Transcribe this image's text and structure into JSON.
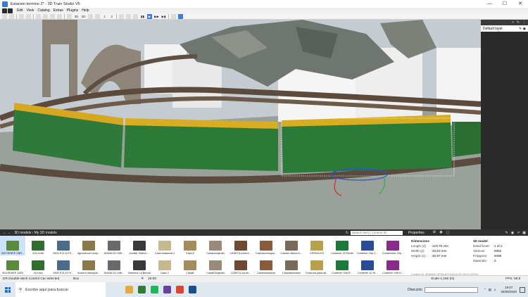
{
  "window": {
    "title": "Estacion termino 2* - 3D Train Studio V5",
    "controls": [
      "—",
      "☐",
      "✕"
    ]
  },
  "menu": [
    "Edit",
    "View",
    "Catalog",
    "Extras",
    "Plugins",
    "Help"
  ],
  "toolbar": {
    "view_3d": "3D",
    "view_2d": "2D",
    "num_1": "1",
    "num_3": "3",
    "play": "▶",
    "pause": "▮▮",
    "ffwd": "▶▶",
    "end": "▶▮"
  },
  "layers": {
    "layer_name": "Default layer"
  },
  "library": {
    "breadcrumb": "3D models › My 3D models",
    "search_placeholder": "Search item | Content ID",
    "row1": [
      "269 RENFE VBR...",
      "319 renfe",
      "5000 R.E.N.F.E...",
      "Agricultural comp...",
      "ANUNCIO LIMI...",
      "Auxiliar Station ...",
      "Casa andaluza 1",
      "Casa E",
      "Casacorujardin",
      "CASETA control ...",
      "Casetaconsigna...",
      "Caseta oficios m...",
      "CEREALES",
      "Contener 20 Renfe",
      "Contener 20p C...",
      "Contenedor 20p..."
    ],
    "row2": [
      "303 RENFE 1953",
      "319 tosi",
      "5000 R.E.N.F.E...",
      "Ancient trainstyle...",
      "ANUNCIO LIMI...",
      "Bahnhof La Brinda",
      "Casa C",
      "CasaB",
      "CasaE2tejardin",
      "CASETA via eb...",
      "Casetadedotras",
      "Casetasemales",
      "Columna yasa ati...",
      "Contener 20ft R...",
      "Contener 40 Hi...",
      "Contener 40ft H..."
    ]
  },
  "properties": {
    "title": "Properties",
    "dimensions_heading": "Dimensions",
    "length_label": "Length (x):",
    "length_value": "123,75 mm",
    "width_label": "Width (y):",
    "width_value": "20,53 mm",
    "height_label": "Height (z):",
    "height_value": "30,67 mm",
    "models_heading": "3D model",
    "detail_label": "Detail level:",
    "detail_value": "1 of 2",
    "vertices_label": "Vertices:",
    "vertices_value": "9352",
    "polygons_label": "Polygons:",
    "polygons_value": "8498",
    "materials_label": "Materials:",
    "materials_value": "3",
    "content_id": "Content ID: 8E6934E-9F56-4EF4-8218-2FC3D47CDF00",
    "fps": "FPS: 59,9"
  },
  "status": {
    "selection": "DR Double-deck Control Car selected",
    "shape": "Box",
    "time": "15:00",
    "scale": "Scale 1:160 (N)"
  },
  "taskbar": {
    "search_text": "Escribe aquí para buscar",
    "address_label": "Dirección",
    "clock_time": "19:07",
    "clock_date": "26/08/2020"
  }
}
